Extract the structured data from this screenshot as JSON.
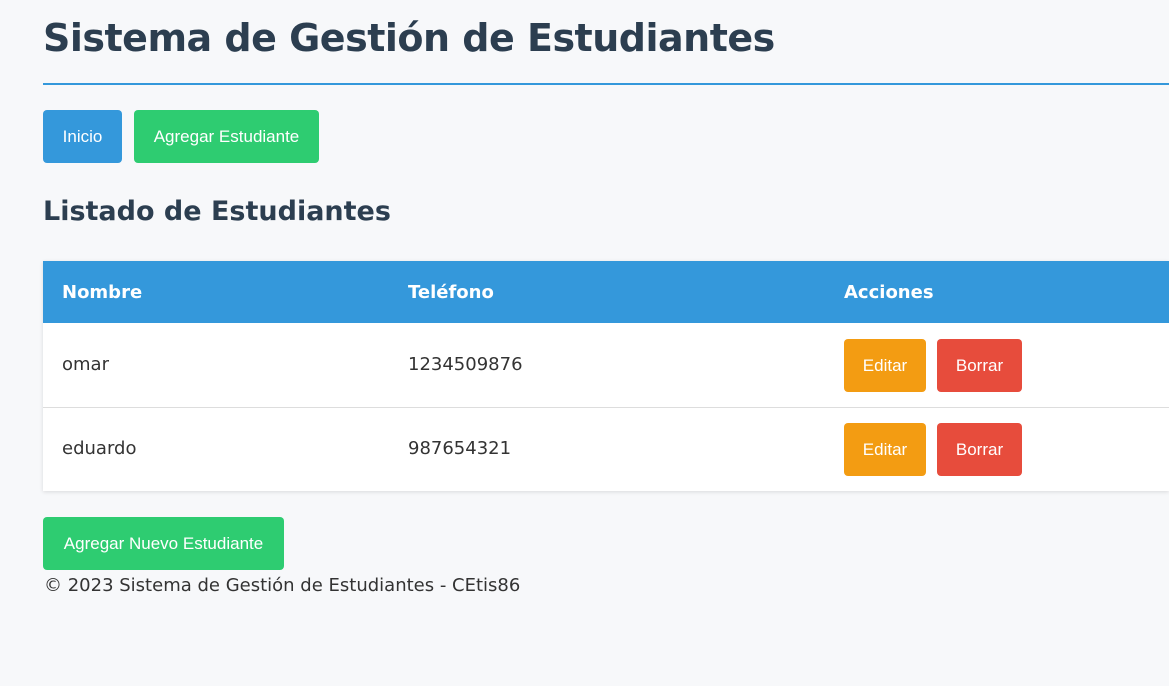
{
  "header": {
    "title": "Sistema de Gestión de Estudiantes"
  },
  "nav": {
    "home_label": "Inicio",
    "add_label": "Agregar Estudiante"
  },
  "list": {
    "title": "Listado de Estudiantes",
    "columns": [
      "Nombre",
      "Teléfono",
      "Acciones"
    ],
    "rows": [
      {
        "name": "omar",
        "phone": "1234509876",
        "edit_label": "Editar",
        "delete_label": "Borrar"
      },
      {
        "name": "eduardo",
        "phone": "987654321",
        "edit_label": "Editar",
        "delete_label": "Borrar"
      }
    ]
  },
  "add_new_label": "Agregar Nuevo Estudiante",
  "footer": {
    "text": "© 2023 Sistema de Gestión de Estudiantes - CEtis86"
  },
  "colors": {
    "primary": "#3498db",
    "success": "#2ecc71",
    "warning": "#f39c12",
    "danger": "#e74c3c",
    "heading": "#2c3e50",
    "background": "#f7f8fa"
  }
}
